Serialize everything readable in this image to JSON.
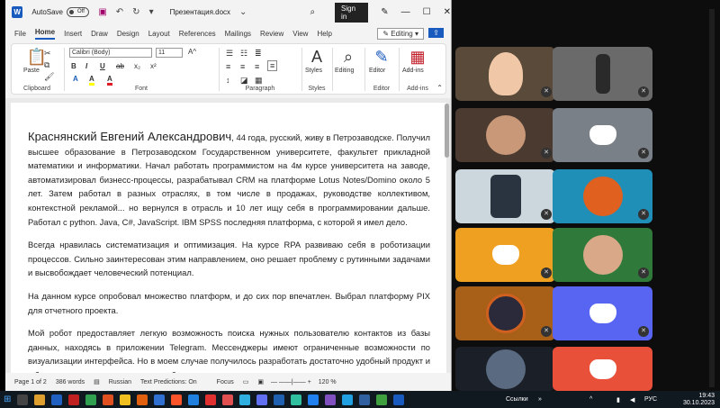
{
  "word": {
    "title_bar": {
      "autosave_label": "AutoSave",
      "autosave_state": "Off",
      "doc_name": "Презентация.docx",
      "signin": "Sign in"
    },
    "menu": [
      "File",
      "Home",
      "Insert",
      "Draw",
      "Design",
      "Layout",
      "References",
      "Mailings",
      "Review",
      "View",
      "Help"
    ],
    "active_tab": "Home",
    "editing_btn": "Editing",
    "ribbon": {
      "clipboard": {
        "paste": "Paste",
        "label": "Clipboard"
      },
      "font": {
        "name": "Calibri (Body)",
        "size": "11",
        "label": "Font",
        "buttons": [
          "B",
          "I",
          "U",
          "ab",
          "x₂",
          "x²",
          "A",
          "A",
          "A"
        ]
      },
      "paragraph": {
        "label": "Paragraph"
      },
      "styles": {
        "btn": "Styles",
        "label": "Styles"
      },
      "editing": {
        "btn": "Editing"
      },
      "editor": {
        "btn": "Editor",
        "label": "Editor"
      },
      "addins": {
        "btn": "Add-ins",
        "label": "Add-ins"
      }
    },
    "doc": {
      "name": "Краснянский Евгений Александрович",
      "p1_rest": ", 44 года, русский, живу в Петрозаводске. Получил высшее образование в Петрозаводском Государственном университете, факультет прикладной математики и информатики. Начал работать программистом на 4м курсе университета на заводе, автоматизировал бизнесс-процессы, разрабатывал CRM на платформе Lotus Notes/Domino около 5 лет. Затем работал в разных отраслях, в том числе в продажах, руководстве коллективом, контекстной рекламой... но вернулся в отрасль и 10 лет ищу себя в программировании дальше. Работал с python. Java, C#, JavaScript. IBM SPSS последняя платформа, с которой я имел дело.",
      "p2": "Всегда нравилась систематизация и оптимизация. На курсе RPA развиваю себя в роботизации процессов. Сильно заинтересован этим направлением, оно решает проблему с рутинными задачами и высвобождает человеческий потенциал.",
      "p3": "На данном курсе опробовал множество платформ, и до сих пор впечатлен. Выбрал платформу PIX для отчетного проекта.",
      "p4": "Мой робот предоставляет легкую возможность поиска нужных пользователю контактов из базы данных, находясь в приложении Telegram. Мессенджеры имеют ограниченные возможности по визуализации интерфейса. Но в моем случае получилось разработать достаточно удобный продукт и с большими возможностями масштабирования."
    },
    "status": {
      "page": "Page 1 of 2",
      "words": "386 words",
      "lang": "Russian",
      "predictions": "Text Predictions: On",
      "focus": "Focus",
      "zoom": "120 %"
    }
  },
  "taskbar": {
    "links": "Ссылки",
    "lang": "РУС",
    "time": "19:43",
    "date": "30.10.2023"
  },
  "colors": {
    "word_blue": "#185abd",
    "discord_blurple": "#5865f2",
    "discord_orange": "#f0a020",
    "discord_red": "#e8503a"
  }
}
